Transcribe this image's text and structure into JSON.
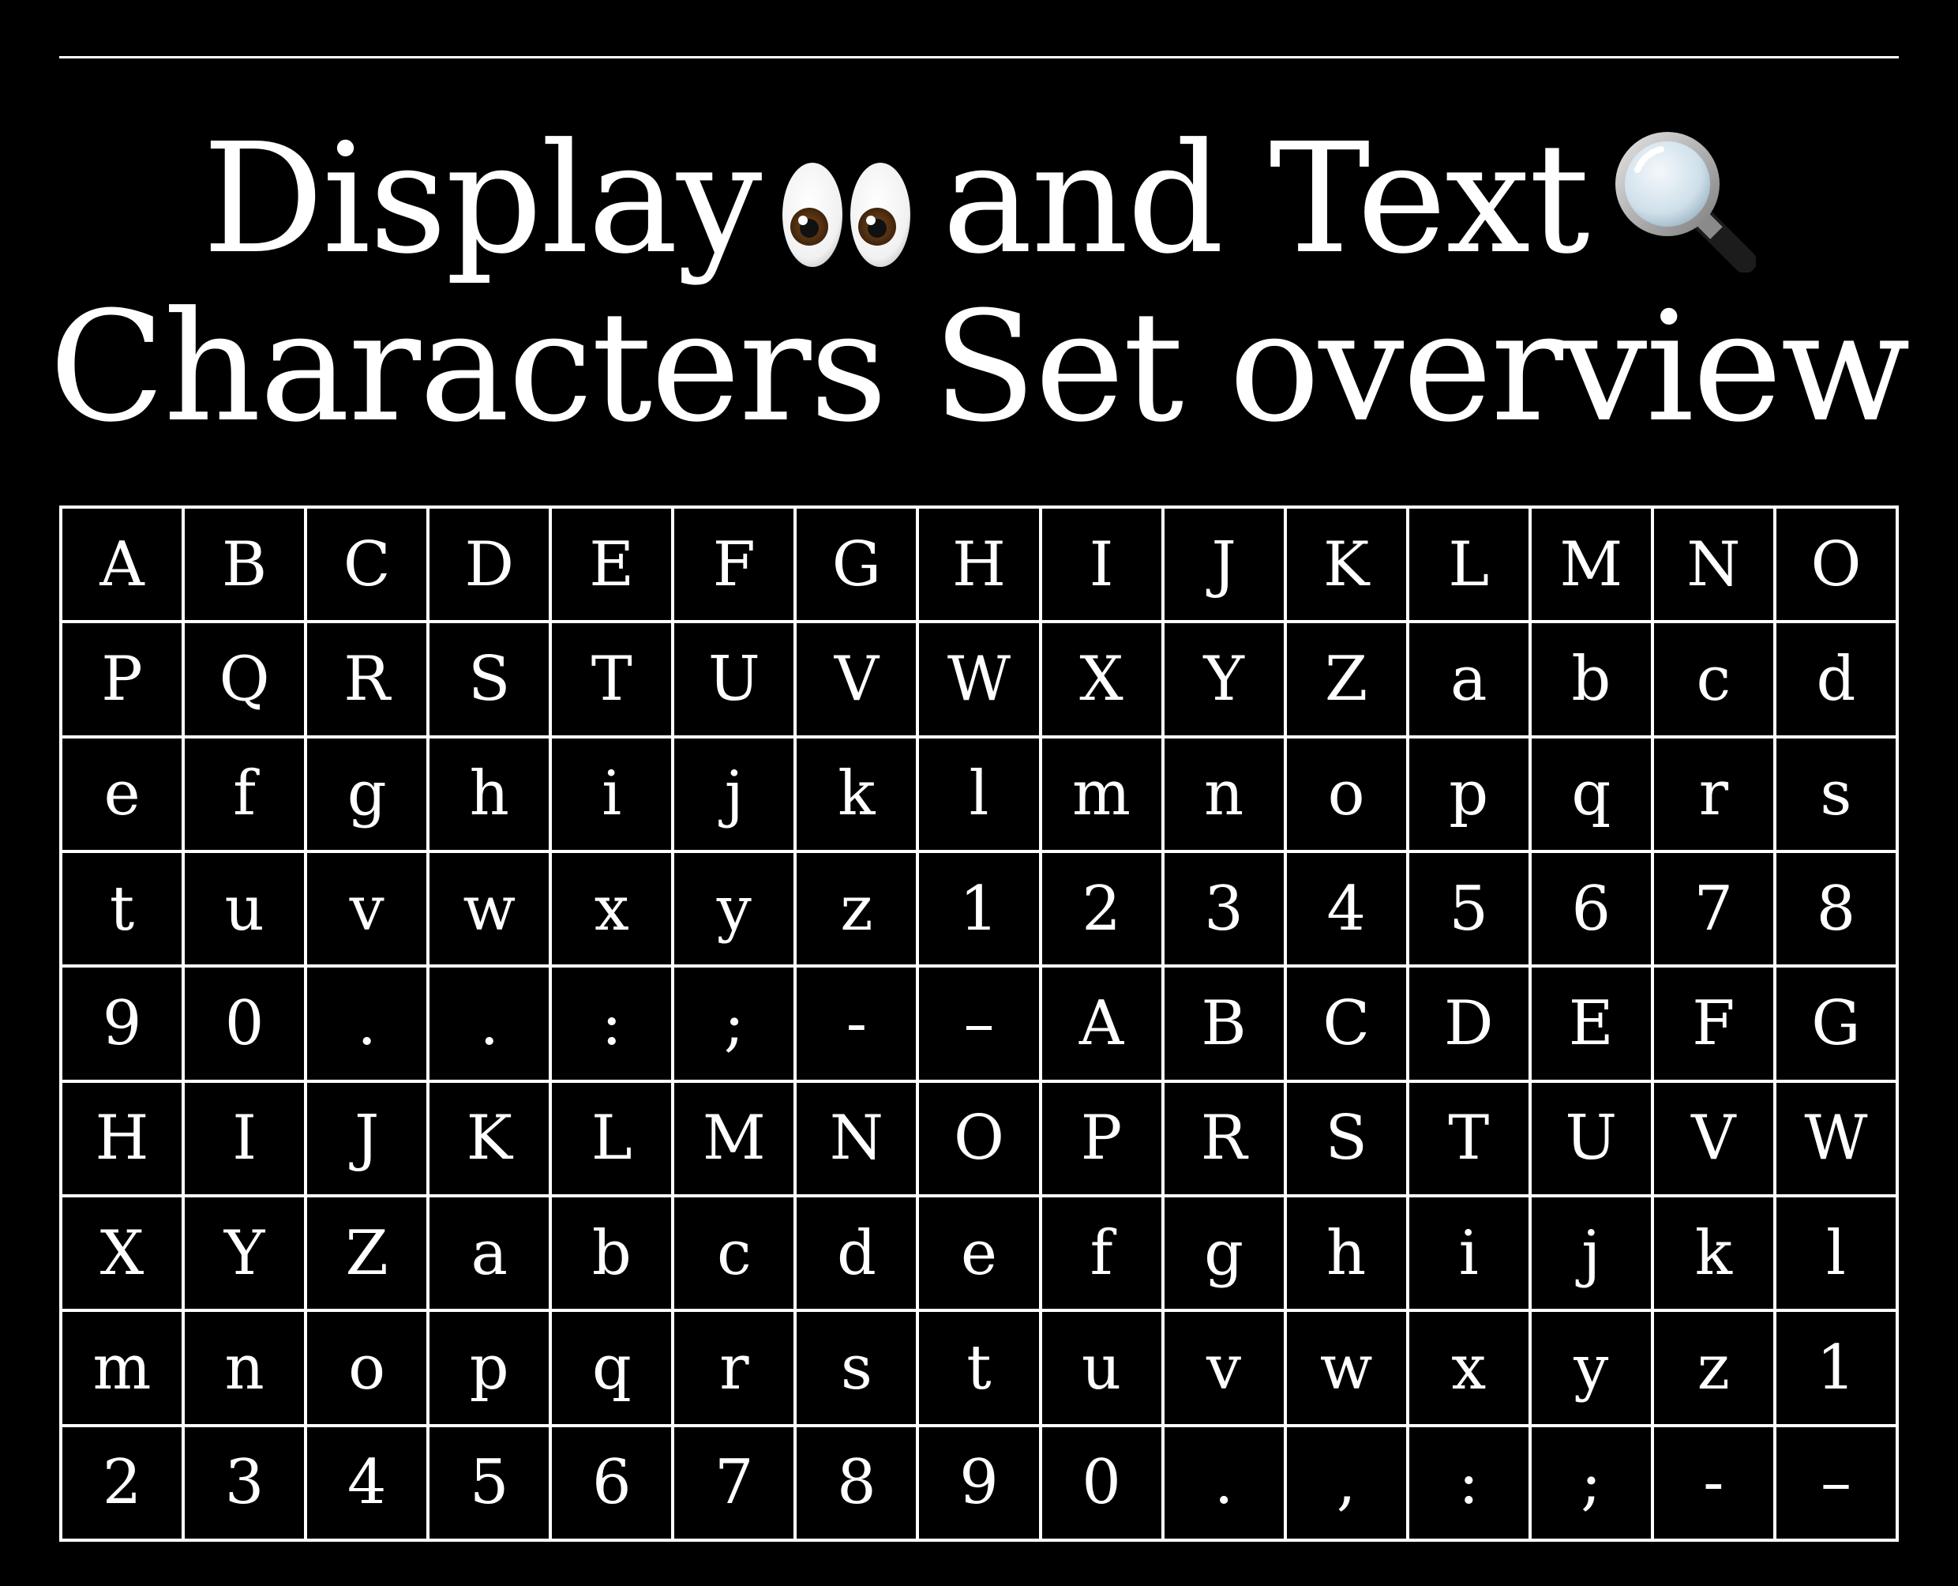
{
  "title": {
    "line1_part1": "Display",
    "line1_icon1": "eyes-icon",
    "line1_part2": "and Text",
    "line1_icon2": "magnifying-glass-icon",
    "line2": "Characters Set overview"
  },
  "colors": {
    "background": "#000000",
    "foreground": "#ffffff"
  },
  "grid": {
    "rows": [
      [
        "A",
        "B",
        "C",
        "D",
        "E",
        "F",
        "G",
        "H",
        "I",
        "J",
        "K",
        "L",
        "M",
        "N",
        "O"
      ],
      [
        "P",
        "Q",
        "R",
        "S",
        "T",
        "U",
        "V",
        "W",
        "X",
        "Y",
        "Z",
        "a",
        "b",
        "c",
        "d"
      ],
      [
        "e",
        "f",
        "g",
        "h",
        "i",
        "j",
        "k",
        "l",
        "m",
        "n",
        "o",
        "p",
        "q",
        "r",
        "s"
      ],
      [
        "t",
        "u",
        "v",
        "w",
        "x",
        "y",
        "z",
        "1",
        "2",
        "3",
        "4",
        "5",
        "6",
        "7",
        "8"
      ],
      [
        "9",
        "0",
        ".",
        ".",
        ":",
        ";",
        "-",
        "–",
        "A",
        "B",
        "C",
        "D",
        "E",
        "F",
        "G"
      ],
      [
        "H",
        "I",
        "J",
        "K",
        "L",
        "M",
        "N",
        "O",
        "P",
        "R",
        "S",
        "T",
        "U",
        "V",
        "W"
      ],
      [
        "X",
        "Y",
        "Z",
        "a",
        "b",
        "c",
        "d",
        "e",
        "f",
        "g",
        "h",
        "i",
        "j",
        "k",
        "l"
      ],
      [
        "m",
        "n",
        "o",
        "p",
        "q",
        "r",
        "s",
        "t",
        "u",
        "v",
        "w",
        "x",
        "y",
        "z",
        "1"
      ],
      [
        "2",
        "3",
        "4",
        "5",
        "6",
        "7",
        "8",
        "9",
        "0",
        ".",
        ",",
        ":",
        ";",
        "-",
        "–"
      ]
    ]
  }
}
